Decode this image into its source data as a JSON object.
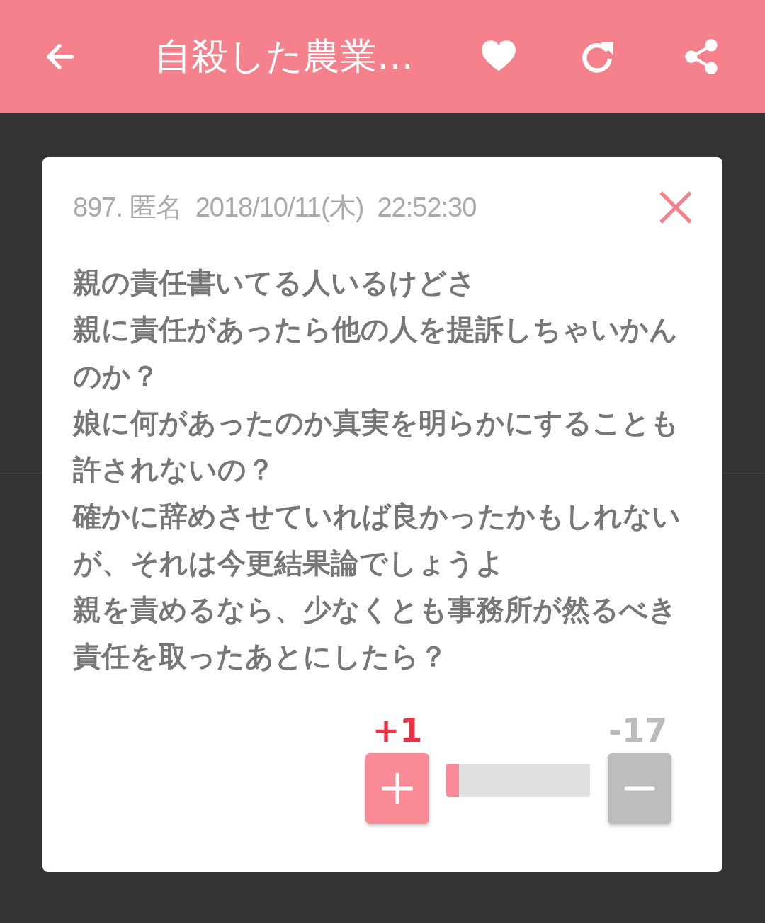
{
  "app_bar": {
    "title": "自殺した農業…"
  },
  "dialog": {
    "meta": "897. 匿名  2018/10/11(木)  22:52:30",
    "body_lines": [
      "親の責任書いてる人いるけどさ",
      "親に責任があったら他の人を提訴しちゃいかん",
      "のか？",
      "娘に何があったのか真実を明らかにすることも",
      "許されないの？",
      "確かに辞めさせていれば良かったかもしれない",
      "が、それは今更結果論でしょうよ",
      "親を責めるなら、少なくとも事務所が然るべき",
      "責任を取ったあとにしたら？"
    ],
    "votes": {
      "plus_count": "+1",
      "minus_count": "-17",
      "level": 0.09
    }
  }
}
